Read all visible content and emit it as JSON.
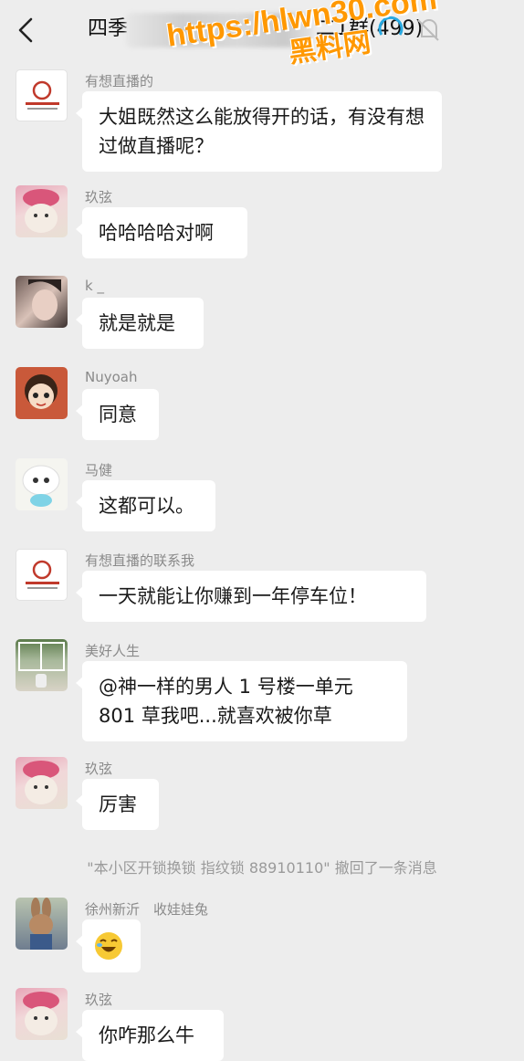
{
  "header": {
    "title": "四季",
    "title_suffix": "二1群(499)",
    "back_icon": "chevron-left-icon"
  },
  "watermark": {
    "url": "https:/hlwn30.com",
    "cn": "黑料网"
  },
  "messages": [
    {
      "sender": "有想直播的",
      "text": "大姐既然这么能放得开的话，有没有想过做直播呢？",
      "avatar": "logo-avatar"
    },
    {
      "sender": "玖弦",
      "text": "哈哈哈哈对啊",
      "avatar": "cat-avatar"
    },
    {
      "sender": "k _",
      "text": "就是就是",
      "avatar": "photo-avatar"
    },
    {
      "sender": "Nuyoah",
      "text": "同意",
      "avatar": "cartoon-girl-avatar"
    },
    {
      "sender": "马健",
      "text": "这都可以。",
      "avatar": "sheep-avatar"
    },
    {
      "sender": "有想直播的联系我",
      "text": "一天就能让你赚到一年停车位！",
      "avatar": "logo-avatar"
    },
    {
      "sender": "美好人生",
      "text": "@神一样的男人 1 号楼一单元 801 草我吧...就喜欢被你草",
      "avatar": "window-avatar"
    },
    {
      "sender": "玖弦",
      "text": "厉害",
      "avatar": "cat-avatar"
    },
    {
      "sender": "徐州新沂　收娃娃兔",
      "text": "",
      "avatar": "rabbit-avatar"
    },
    {
      "sender": "玖弦",
      "text": "你咋那么牛",
      "avatar": "cat-avatar"
    }
  ],
  "system_notice": "\"本小区开锁换锁 指纹锁 88910110\" 撤回了一条消息",
  "colors": {
    "background": "#ededed",
    "bubble": "#ffffff",
    "watermark": "#ff9800"
  }
}
